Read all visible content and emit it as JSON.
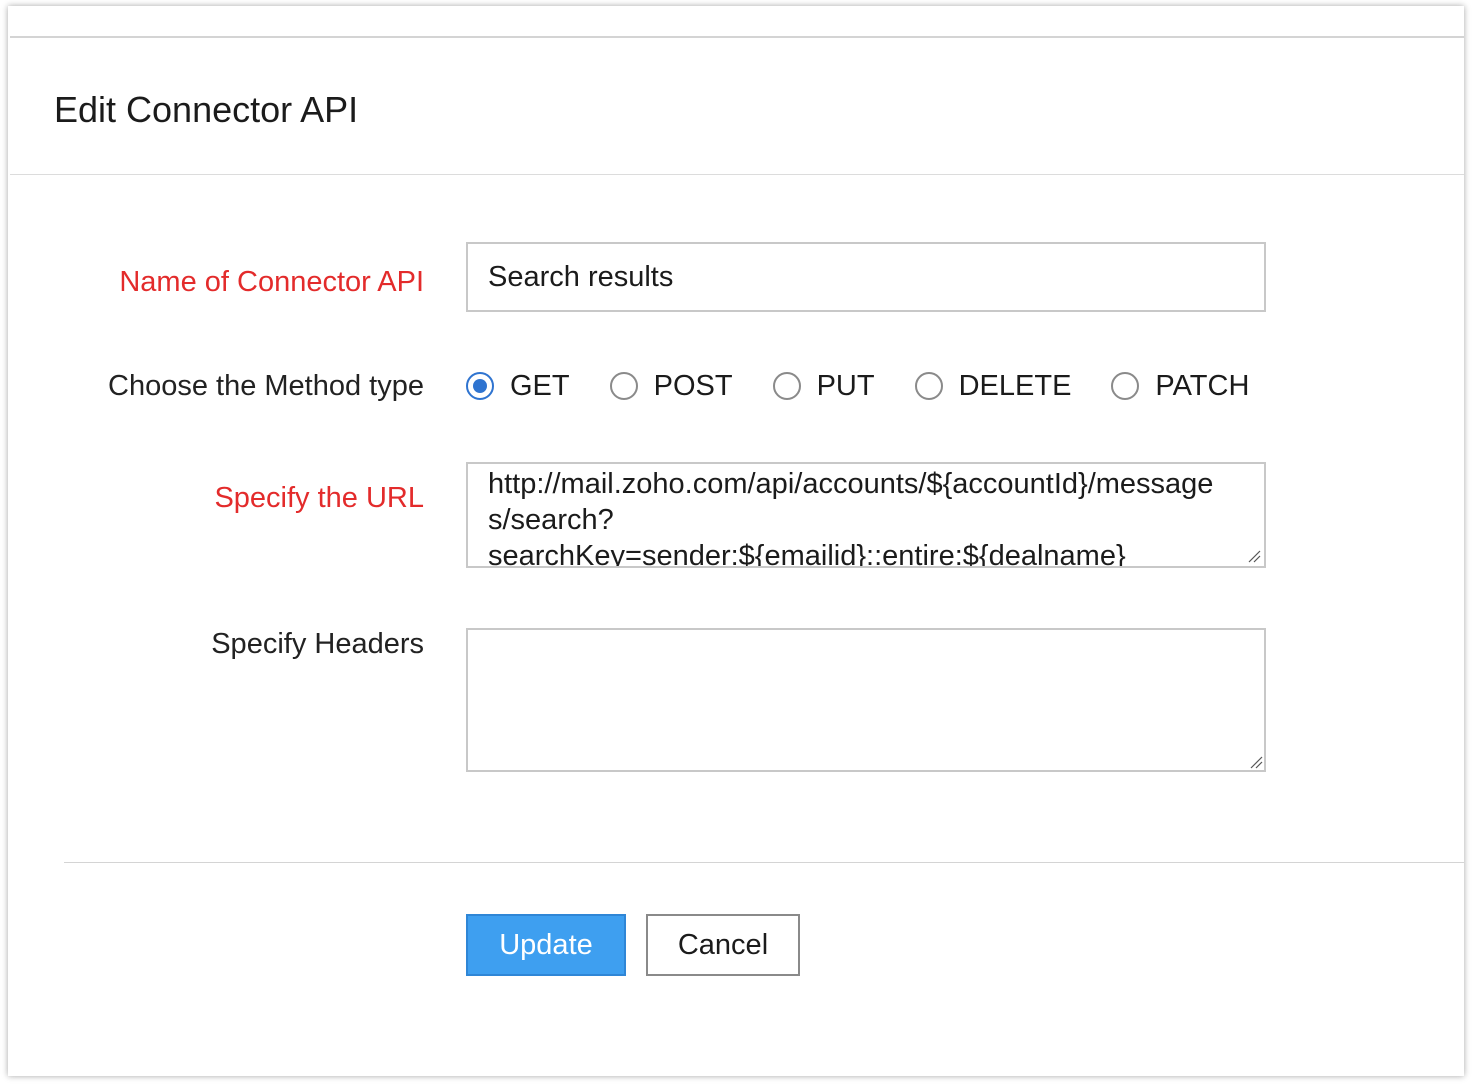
{
  "dialog": {
    "title": "Edit Connector API"
  },
  "form": {
    "name_label": "Name of Connector API",
    "name_value": "Search results",
    "method_label": "Choose the Method type",
    "methods": [
      {
        "label": "GET",
        "checked": true
      },
      {
        "label": "POST",
        "checked": false
      },
      {
        "label": "PUT",
        "checked": false
      },
      {
        "label": "DELETE",
        "checked": false
      },
      {
        "label": "PATCH",
        "checked": false
      }
    ],
    "url_label": "Specify the URL",
    "url_value": "http://mail.zoho.com/api/accounts/${accountId}/messages/search?searchKey=sender:${emailid}::entire:${dealname}",
    "url_lines": [
      "http://mail.zoho.com/api/accounts/${accountId}/message",
      "s/search?",
      "searchKey=sender:${emailid}::entire:${dealname}"
    ],
    "headers_label": "Specify Headers",
    "headers_value": ""
  },
  "actions": {
    "update_label": "Update",
    "cancel_label": "Cancel"
  },
  "colors": {
    "required_label": "#e32b2b",
    "primary_button": "#3e9ff0",
    "radio_checked": "#2f74d0"
  }
}
